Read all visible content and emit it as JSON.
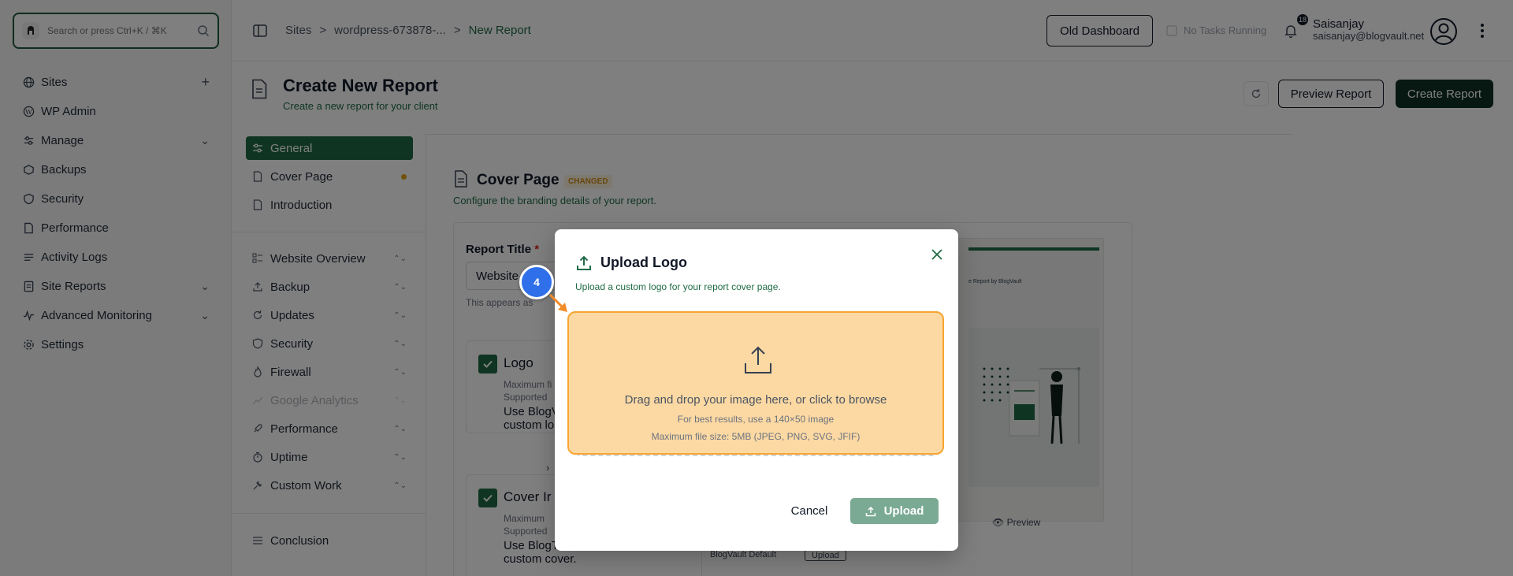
{
  "search": {
    "placeholder": "Search or press Ctrl+K / ⌘K"
  },
  "sidebar": {
    "items": [
      {
        "label": "Sites",
        "icon": "globe-icon",
        "trail": "+"
      },
      {
        "label": "WP Admin",
        "icon": "wordpress-icon",
        "trail": ""
      },
      {
        "label": "Manage",
        "icon": "sliders-icon",
        "trail": "⌄"
      },
      {
        "label": "Backups",
        "icon": "backup-icon",
        "trail": ""
      },
      {
        "label": "Security",
        "icon": "shield-icon",
        "trail": ""
      },
      {
        "label": "Performance",
        "icon": "document-icon",
        "trail": ""
      },
      {
        "label": "Activity Logs",
        "icon": "activity-icon",
        "trail": ""
      },
      {
        "label": "Site Reports",
        "icon": "report-icon",
        "trail": "⌄"
      },
      {
        "label": "Advanced Monitoring",
        "icon": "pulse-icon",
        "trail": "⌄"
      },
      {
        "label": "Settings",
        "icon": "gear-icon",
        "trail": ""
      }
    ]
  },
  "header": {
    "breadcrumb": [
      "Sites",
      "wordpress-673878-...",
      "New Report"
    ],
    "separator": ">",
    "old_dashboard": "Old Dashboard",
    "tasks": "No Tasks Running",
    "notification_count": "18",
    "user_name": "Saisanjay",
    "user_email": "saisanjay@blogvault.net"
  },
  "page": {
    "title": "Create New Report",
    "subtitle": "Create a new report for your client",
    "preview_label": "Preview Report",
    "create_label": "Create Report"
  },
  "report_nav": {
    "top": [
      {
        "label": "General",
        "state": "active"
      },
      {
        "label": "Cover Page",
        "state": "changed"
      },
      {
        "label": "Introduction",
        "state": ""
      }
    ],
    "sections": [
      {
        "label": "Website Overview"
      },
      {
        "label": "Backup"
      },
      {
        "label": "Updates"
      },
      {
        "label": "Security"
      },
      {
        "label": "Firewall"
      },
      {
        "label": "Google Analytics"
      },
      {
        "label": "Performance"
      },
      {
        "label": "Uptime"
      },
      {
        "label": "Custom Work"
      }
    ],
    "conclusion": "Conclusion"
  },
  "cover": {
    "title": "Cover Page",
    "badge": "CHANGED",
    "description": "Configure the branding details of your report.",
    "report_title_label": "Report Title",
    "required_mark": "*",
    "report_title_value": "Website",
    "report_title_hint": "This appears as",
    "logo": {
      "title": "Logo",
      "meta1": "Maximum fi",
      "meta2": "Supported",
      "use1": "Use BlogV",
      "use2": "custom lo"
    },
    "cover_image": {
      "title": "Cover Ir",
      "meta1": "Maximum",
      "meta2": "Supported",
      "use1": "Use BlogT",
      "use2": "custom cover."
    },
    "preview_title": "e Report by BlogVault",
    "preview_caption": "Preview",
    "bottom_left": "BlogVault Default",
    "bottom_right": "Upload"
  },
  "modal": {
    "title": "Upload Logo",
    "description": "Upload a custom logo for your report cover page.",
    "dropzone_main": "Drag and drop your image here, or click to browse",
    "dropzone_hint": "For best results, use a 140×50 image",
    "dropzone_limits": "Maximum file size: 5MB (JPEG, PNG, SVG, JFIF)",
    "cancel": "Cancel",
    "upload": "Upload"
  },
  "step": {
    "number": "4"
  },
  "colors": {
    "brand_green": "#1f6b45",
    "dark_green": "#0f2f22",
    "highlight_orange": "#f6a531",
    "highlight_fill": "#fcd9a3",
    "step_blue": "#2f6fea",
    "changed_amber": "#e0a31a"
  }
}
